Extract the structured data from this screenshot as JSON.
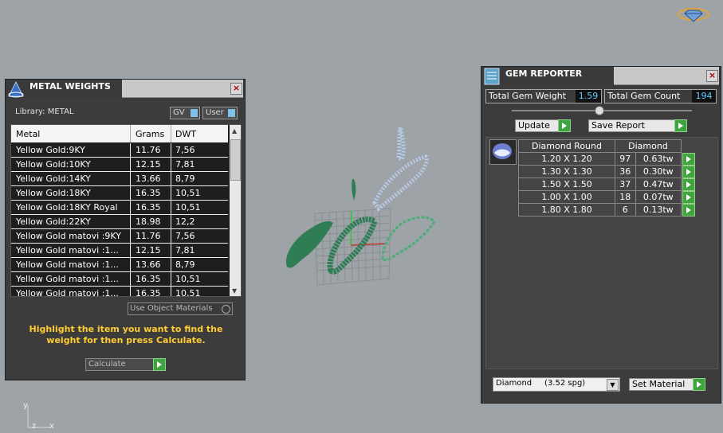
{
  "metal_weights": {
    "title": "METAL WEIGHTS",
    "library_label": "Library: METAL",
    "gv_label": "GV",
    "user_label": "User",
    "columns": [
      "Metal",
      "Grams",
      "DWT"
    ],
    "rows": [
      {
        "metal": "Yellow Gold:9KY",
        "grams": "11.76",
        "dwt": "7,56"
      },
      {
        "metal": "Yellow Gold:10KY",
        "grams": "12.15",
        "dwt": "7,81"
      },
      {
        "metal": "Yellow Gold:14KY",
        "grams": "13.66",
        "dwt": "8,79"
      },
      {
        "metal": "Yellow Gold:18KY",
        "grams": "16.35",
        "dwt": "10,51"
      },
      {
        "metal": "Yellow Gold:18KY Royal",
        "grams": "16.35",
        "dwt": "10,51"
      },
      {
        "metal": "Yellow Gold:22KY",
        "grams": "18.98",
        "dwt": "12,2"
      },
      {
        "metal": "Yellow Gold matovi :9KY",
        "grams": "11.76",
        "dwt": "7,56"
      },
      {
        "metal": "Yellow Gold matovi :1...",
        "grams": "12.15",
        "dwt": "7,81"
      },
      {
        "metal": "Yellow Gold matovi :1...",
        "grams": "13.66",
        "dwt": "8,79"
      },
      {
        "metal": "Yellow Gold matovi :1...",
        "grams": "16.35",
        "dwt": "10,51"
      },
      {
        "metal": "Yellow Gold matovi :1...",
        "grams": "16.35",
        "dwt": "10,51"
      }
    ],
    "use_object_materials": "Use Object Materials",
    "hint": "Highlight the item you want to find the weight for then press Calculate.",
    "calculate_label": "Calculate"
  },
  "gem_reporter": {
    "title": "GEM REPORTER",
    "total_weight_label": "Total Gem Weight",
    "total_weight_value": "1.59",
    "total_count_label": "Total Gem Count",
    "total_count_value": "194",
    "update_label": "Update",
    "save_report_label": "Save Report",
    "col_shape": "Diamond Round",
    "col_material": "Diamond",
    "rows": [
      {
        "size": "1.20 X 1.20",
        "count": "97",
        "weight": "0.63tw"
      },
      {
        "size": "1.30 X 1.30",
        "count": "36",
        "weight": "0.30tw"
      },
      {
        "size": "1.50 X 1.50",
        "count": "37",
        "weight": "0.47tw"
      },
      {
        "size": "1.00 X 1.00",
        "count": "18",
        "weight": "0.07tw"
      },
      {
        "size": "1.80 X 1.80",
        "count": "6",
        "weight": "0.13tw"
      }
    ],
    "material_select": "Diamond     (3.52 spg)",
    "set_material_label": "Set Material"
  },
  "axis": {
    "y": "y",
    "x": "x",
    "z": "z"
  },
  "colors": {
    "panel": "#3c3c3c",
    "accent_yellow": "#ffcc33",
    "accent_green": "#3fa33f",
    "value_blue": "#66ccff",
    "model_green": "#2e8b57",
    "model_blue": "#a9c4e6"
  }
}
